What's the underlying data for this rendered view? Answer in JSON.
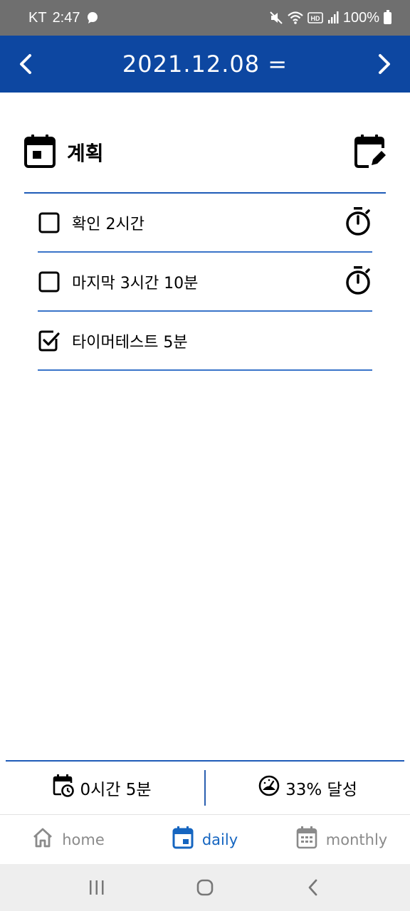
{
  "status_bar": {
    "carrier": "KT",
    "time": "2:47",
    "battery": "100%",
    "icons": [
      "chat-bubble-icon",
      "mute-icon",
      "wifi-icon",
      "hd-icon",
      "signal-icon",
      "battery-icon"
    ]
  },
  "header": {
    "title": "2021.12.08 =",
    "prev_icon": "chevron-left-icon",
    "next_icon": "chevron-right-icon",
    "color": "#0d47a1"
  },
  "section": {
    "title": "계획",
    "icon": "calendar-today-icon",
    "edit_icon": "calendar-edit-icon"
  },
  "tasks": [
    {
      "label": "확인 2시간",
      "checked": false,
      "has_timer": true
    },
    {
      "label": "마지막 3시간 10분",
      "checked": false,
      "has_timer": true
    },
    {
      "label": "타이머테스트 5분",
      "checked": true,
      "has_timer": false
    }
  ],
  "summary": {
    "time_total": "0시간 5분",
    "achievement": "33% 달성"
  },
  "bottom_nav": {
    "items": [
      {
        "label": "home",
        "icon": "home-icon",
        "active": false
      },
      {
        "label": "daily",
        "icon": "calendar-day-icon",
        "active": true
      },
      {
        "label": "monthly",
        "icon": "calendar-month-icon",
        "active": false
      }
    ],
    "active_color": "#1565c0",
    "inactive_color": "#8a8a8a"
  },
  "system_nav": {
    "icons": [
      "recent-apps-icon",
      "home-button-icon",
      "back-icon"
    ]
  }
}
